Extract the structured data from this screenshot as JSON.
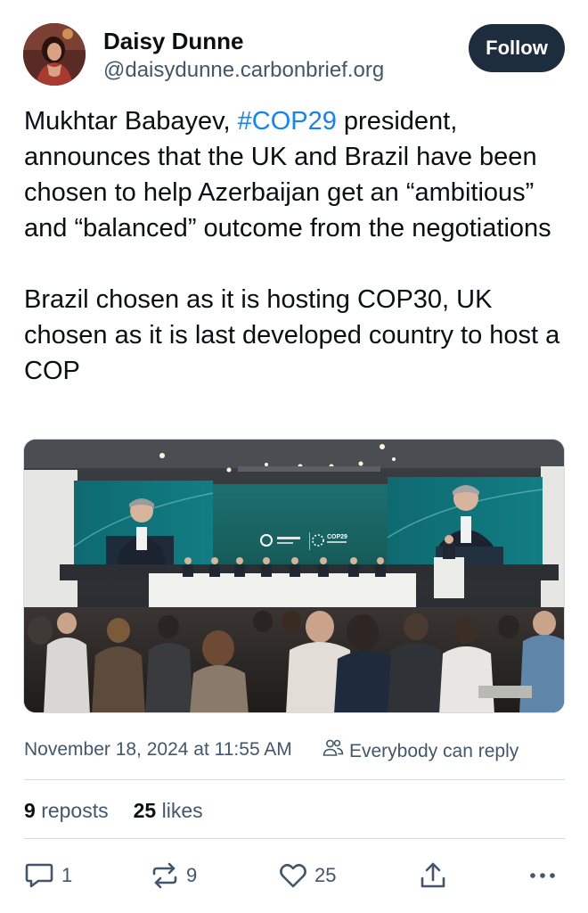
{
  "author": {
    "display_name": "Daisy Dunne",
    "handle": "@daisydunne.carbonbrief.org",
    "follow_label": "Follow"
  },
  "post": {
    "text_before_hashtag": "Mukhtar Babayev, ",
    "hashtag": "#COP29",
    "text_after_hashtag": " president, announces that the UK and Brazil have been chosen to help Azerbaijan get an “ambitious” and “balanced” outcome from the negotiations",
    "paragraph2": "Brazil chosen as it is hosting COP30, UK chosen as it is last developed country to host a COP"
  },
  "image": {
    "screen_logo_text": "COP29"
  },
  "meta": {
    "timestamp": "November 18, 2024 at 11:55 AM",
    "reply_setting": "Everybody can reply"
  },
  "stats": {
    "reposts_count": "9",
    "reposts_label": "reposts",
    "likes_count": "25",
    "likes_label": "likes"
  },
  "actions": {
    "reply_count": "1",
    "repost_count": "9",
    "like_count": "25"
  },
  "icons": {
    "reply": "reply-icon",
    "repost": "repost-icon",
    "like": "heart-icon",
    "share": "share-icon",
    "more": "more-icon",
    "reply_setting": "people-icon"
  },
  "colors": {
    "accent": "#1083fe",
    "follow_button": "#1e2d3d",
    "secondary_text": "#42576c"
  }
}
